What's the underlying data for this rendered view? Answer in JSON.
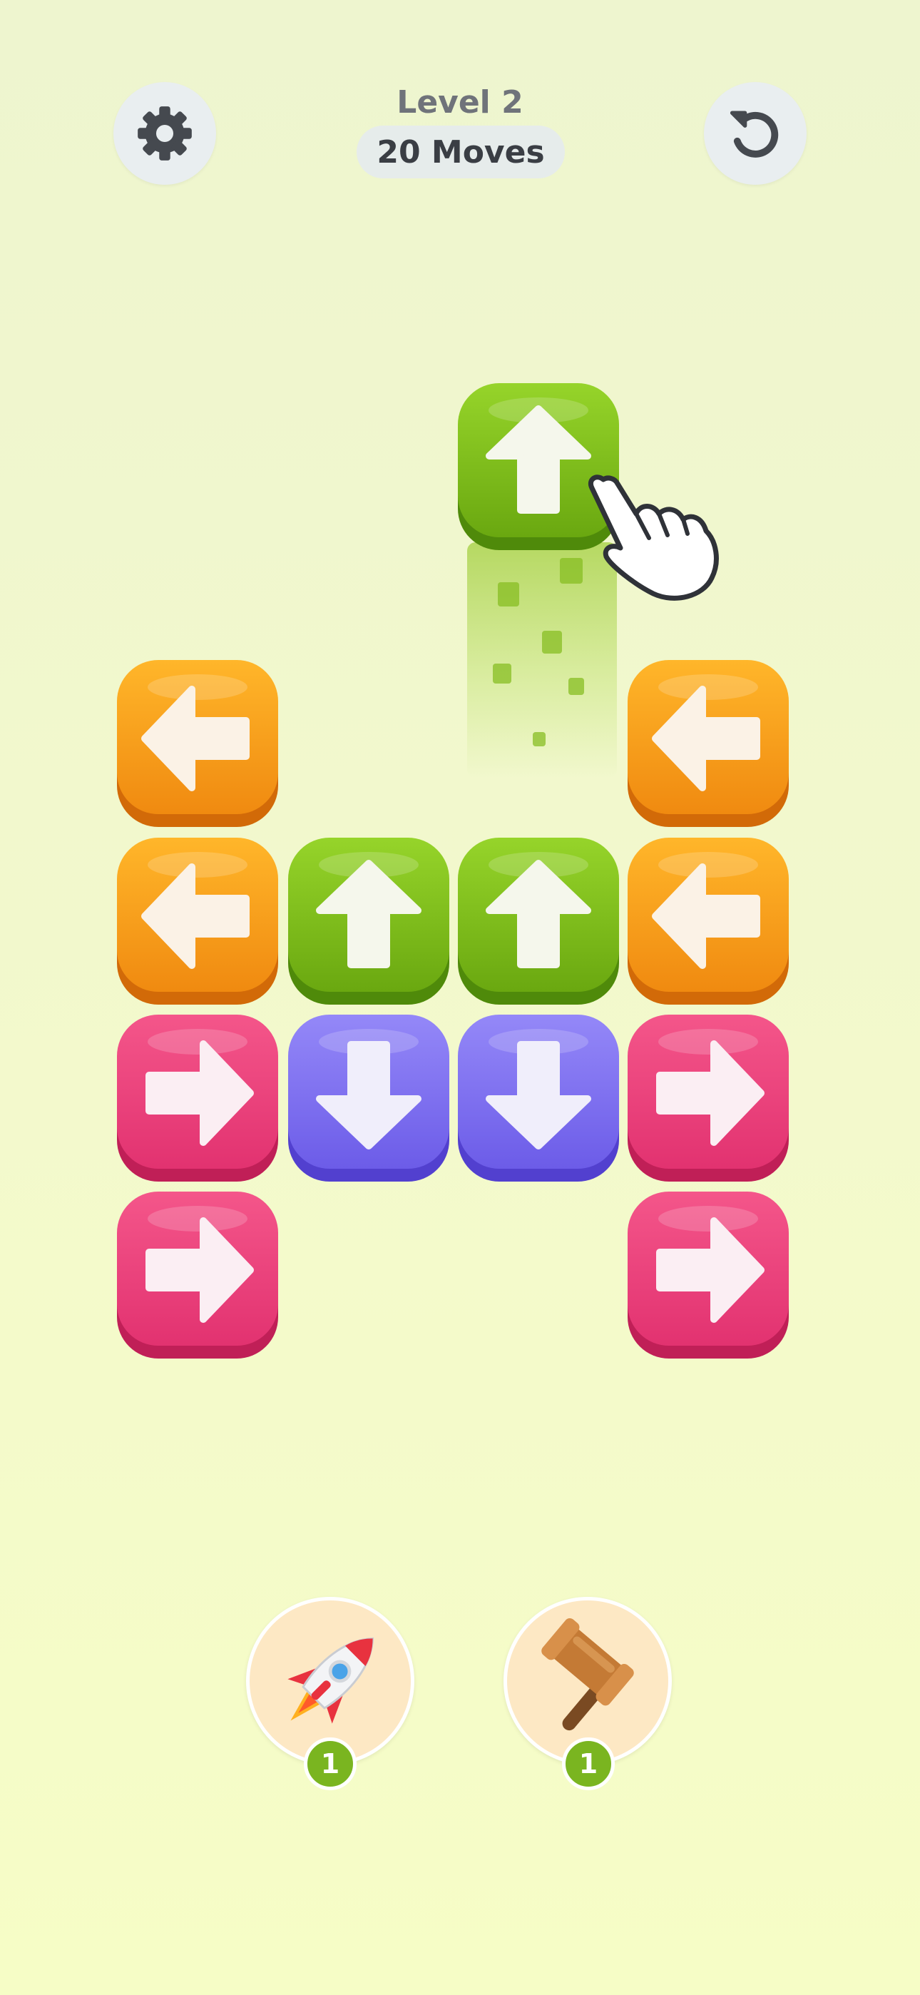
{
  "header": {
    "level": "Level 2",
    "moves": "20 Moves"
  },
  "icons": {
    "settings": "gear-icon",
    "undo": "undo-icon",
    "hint": "pointing-hand-icon",
    "rocket": "rocket-icon",
    "hammer": "hammer-icon"
  },
  "colors": {
    "green": "#7cc420",
    "orange": "#f7a21c",
    "pink": "#ec3f7c",
    "purple": "#7b6cf0",
    "badge": "#7ab520"
  },
  "board": {
    "tiles": [
      {
        "row": 0,
        "col": 2,
        "color": "green",
        "direction": "up",
        "state": "moving"
      },
      {
        "row": 1,
        "col": 0,
        "color": "orange",
        "direction": "left"
      },
      {
        "row": 1,
        "col": 3,
        "color": "orange",
        "direction": "left"
      },
      {
        "row": 2,
        "col": 0,
        "color": "orange",
        "direction": "left"
      },
      {
        "row": 2,
        "col": 1,
        "color": "green",
        "direction": "up"
      },
      {
        "row": 2,
        "col": 2,
        "color": "green",
        "direction": "up"
      },
      {
        "row": 2,
        "col": 3,
        "color": "orange",
        "direction": "left"
      },
      {
        "row": 3,
        "col": 0,
        "color": "pink",
        "direction": "right"
      },
      {
        "row": 3,
        "col": 1,
        "color": "purple",
        "direction": "down"
      },
      {
        "row": 3,
        "col": 2,
        "color": "purple",
        "direction": "down"
      },
      {
        "row": 3,
        "col": 3,
        "color": "pink",
        "direction": "right"
      },
      {
        "row": 4,
        "col": 0,
        "color": "pink",
        "direction": "right"
      },
      {
        "row": 4,
        "col": 3,
        "color": "pink",
        "direction": "right"
      }
    ]
  },
  "boosters": [
    {
      "name": "rocket",
      "count": "1"
    },
    {
      "name": "hammer",
      "count": "1"
    }
  ]
}
